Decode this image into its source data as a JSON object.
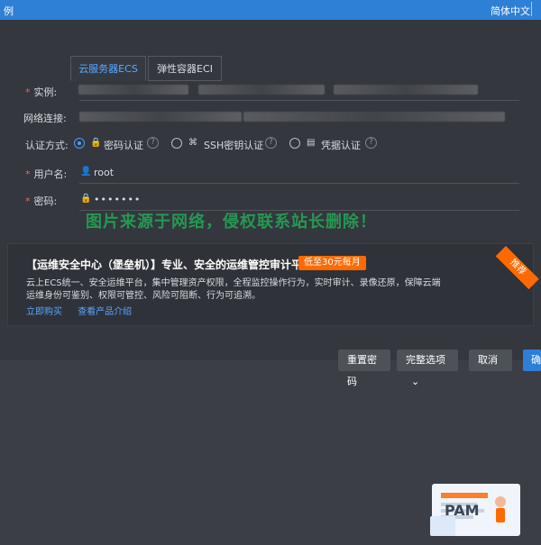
{
  "top_bar": {
    "left_text": "例",
    "language": "简体中文"
  },
  "tabs": [
    {
      "label": "云服务器ECS"
    },
    {
      "label": "弹性容器ECI"
    }
  ],
  "fields": {
    "instance_label": "实例:",
    "network_label": "网络连接:",
    "auth_label": "认证方式:",
    "auth_options": [
      {
        "label": "密码认证"
      },
      {
        "label": "SSH密钥认证"
      },
      {
        "label": "凭据认证"
      }
    ],
    "username_label": "用户名:",
    "username_value": "root",
    "password_label": "密码:",
    "password_value": "•••••••"
  },
  "watermark": "图片来源于网络，侵权联系站长删除！",
  "promo": {
    "title": "【运维安全中心（堡垒机）】专业、安全的运维管控审计平台",
    "badge": "低至30元每月",
    "desc_line1": "云上ECS统一、安全运维平台，集中管理资产权限，全程监控操作行为，实时审计、录像还原，保障云端",
    "desc_line2": "运维身份可鉴别、权限可管控、风险可阻断、行为可追溯。",
    "link_buy": "立即购买",
    "link_info": "查看产品介绍",
    "ribbon": "推荐",
    "card_text": "PAM"
  },
  "buttons": {
    "reset_password": "重置密码",
    "complete_options": "完整选项",
    "cancel": "取消",
    "edge_char": "确"
  },
  "colors": {
    "accent": "#2e7fd6",
    "link": "#58a6ff",
    "badge": "#ff6a00",
    "watermark": "#20be5c"
  }
}
